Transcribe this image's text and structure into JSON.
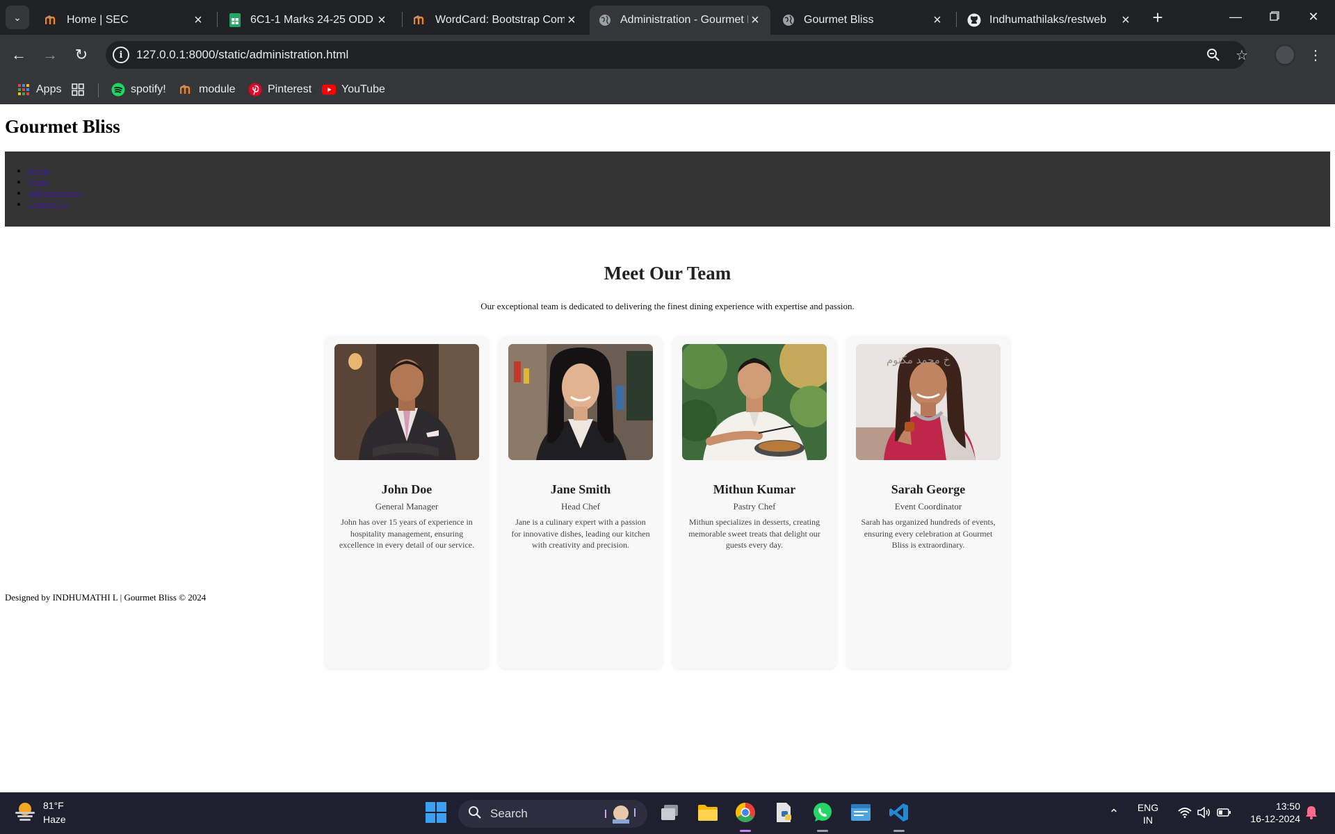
{
  "browser": {
    "tabs": [
      {
        "title": "Home | SEC",
        "icon": "moodle-icon",
        "active": false
      },
      {
        "title": "6C1-1 Marks 24-25 ODD -",
        "icon": "sheets-icon",
        "active": false
      },
      {
        "title": "WordCard: Bootstrap Comp",
        "icon": "moodle-icon",
        "active": false
      },
      {
        "title": "Administration - Gourmet B",
        "icon": "globe-icon",
        "active": true
      },
      {
        "title": "Gourmet Bliss",
        "icon": "globe-icon",
        "active": false
      },
      {
        "title": "Indhumathilaks/restweb",
        "icon": "github-icon",
        "active": false
      }
    ],
    "url": "127.0.0.1:8000/static/administration.html",
    "bookmarks": [
      {
        "label": "Apps",
        "icon": "apps-grid-icon"
      },
      {
        "label": "",
        "icon": "tab-groups-icon"
      },
      {
        "label": "spotify!",
        "icon": "spotify-icon"
      },
      {
        "label": "module",
        "icon": "moodle-icon"
      },
      {
        "label": "Pinterest",
        "icon": "pinterest-icon"
      },
      {
        "label": "YouTube",
        "icon": "youtube-icon"
      }
    ]
  },
  "site": {
    "title": "Gourmet Bliss",
    "nav": [
      "Home",
      "Menu",
      "Administration",
      "Contact Us"
    ],
    "team_heading": "Meet Our Team",
    "team_subtitle": "Our exceptional team is dedicated to delivering the finest dining experience with expertise and passion.",
    "members": [
      {
        "name": "John Doe",
        "role": "General Manager",
        "desc": "John has over 15 years of experience in hospitality management, ensuring excellence in every detail of our service."
      },
      {
        "name": "Jane Smith",
        "role": "Head Chef",
        "desc": "Jane is a culinary expert with a passion for innovative dishes, leading our kitchen with creativity and precision."
      },
      {
        "name": "Mithun Kumar",
        "role": "Pastry Chef",
        "desc": "Mithun specializes in desserts, creating memorable sweet treats that delight our guests every day."
      },
      {
        "name": "Sarah George",
        "role": "Event Coordinator",
        "desc": "Sarah has organized hundreds of events, ensuring every celebration at Gourmet Bliss is extraordinary."
      }
    ],
    "photo_overlay_text": "خ محمد مكتوم",
    "footer": "Designed by INDHUMATHI L | Gourmet Bliss © 2024"
  },
  "taskbar": {
    "temperature": "81°F",
    "condition": "Haze",
    "search_label": "Search",
    "lang_top": "ENG",
    "lang_bottom": "IN",
    "time": "13:50",
    "date": "16-12-2024"
  },
  "colors": {
    "tab_strip": "#202124",
    "toolbar": "#35363a",
    "site_nav_bg": "#333333",
    "card_bg": "#f8f8f8",
    "taskbar": "#1e2030"
  }
}
